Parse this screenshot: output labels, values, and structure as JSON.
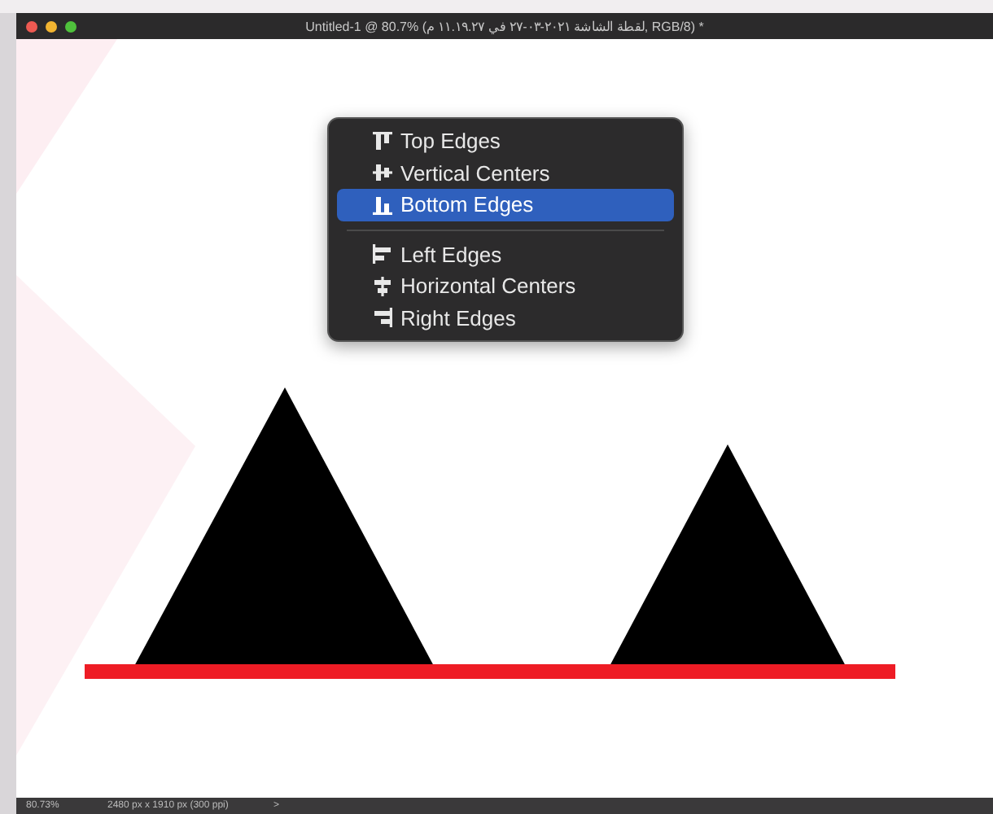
{
  "window": {
    "title": "Untitled-1 @ 80.7% (لقطة الشاشة ٢٠٢١-٠٣-٢٧ في ١١.١٩.٢٧ م, RGB/8) *"
  },
  "menu": {
    "items": [
      {
        "kind": "item",
        "label": "Top Edges",
        "selected": false
      },
      {
        "kind": "item",
        "label": "Vertical Centers",
        "selected": false
      },
      {
        "kind": "item",
        "label": "Bottom Edges",
        "selected": true
      },
      {
        "kind": "separator"
      },
      {
        "kind": "item",
        "label": "Left Edges",
        "selected": false
      },
      {
        "kind": "item",
        "label": "Horizontal Centers",
        "selected": false
      },
      {
        "kind": "item",
        "label": "Right Edges",
        "selected": false
      }
    ]
  },
  "status_bar": {
    "zoom": "80.73%",
    "document_size": "2480 px x 1910 px (300 ppi)",
    "more": ">"
  }
}
